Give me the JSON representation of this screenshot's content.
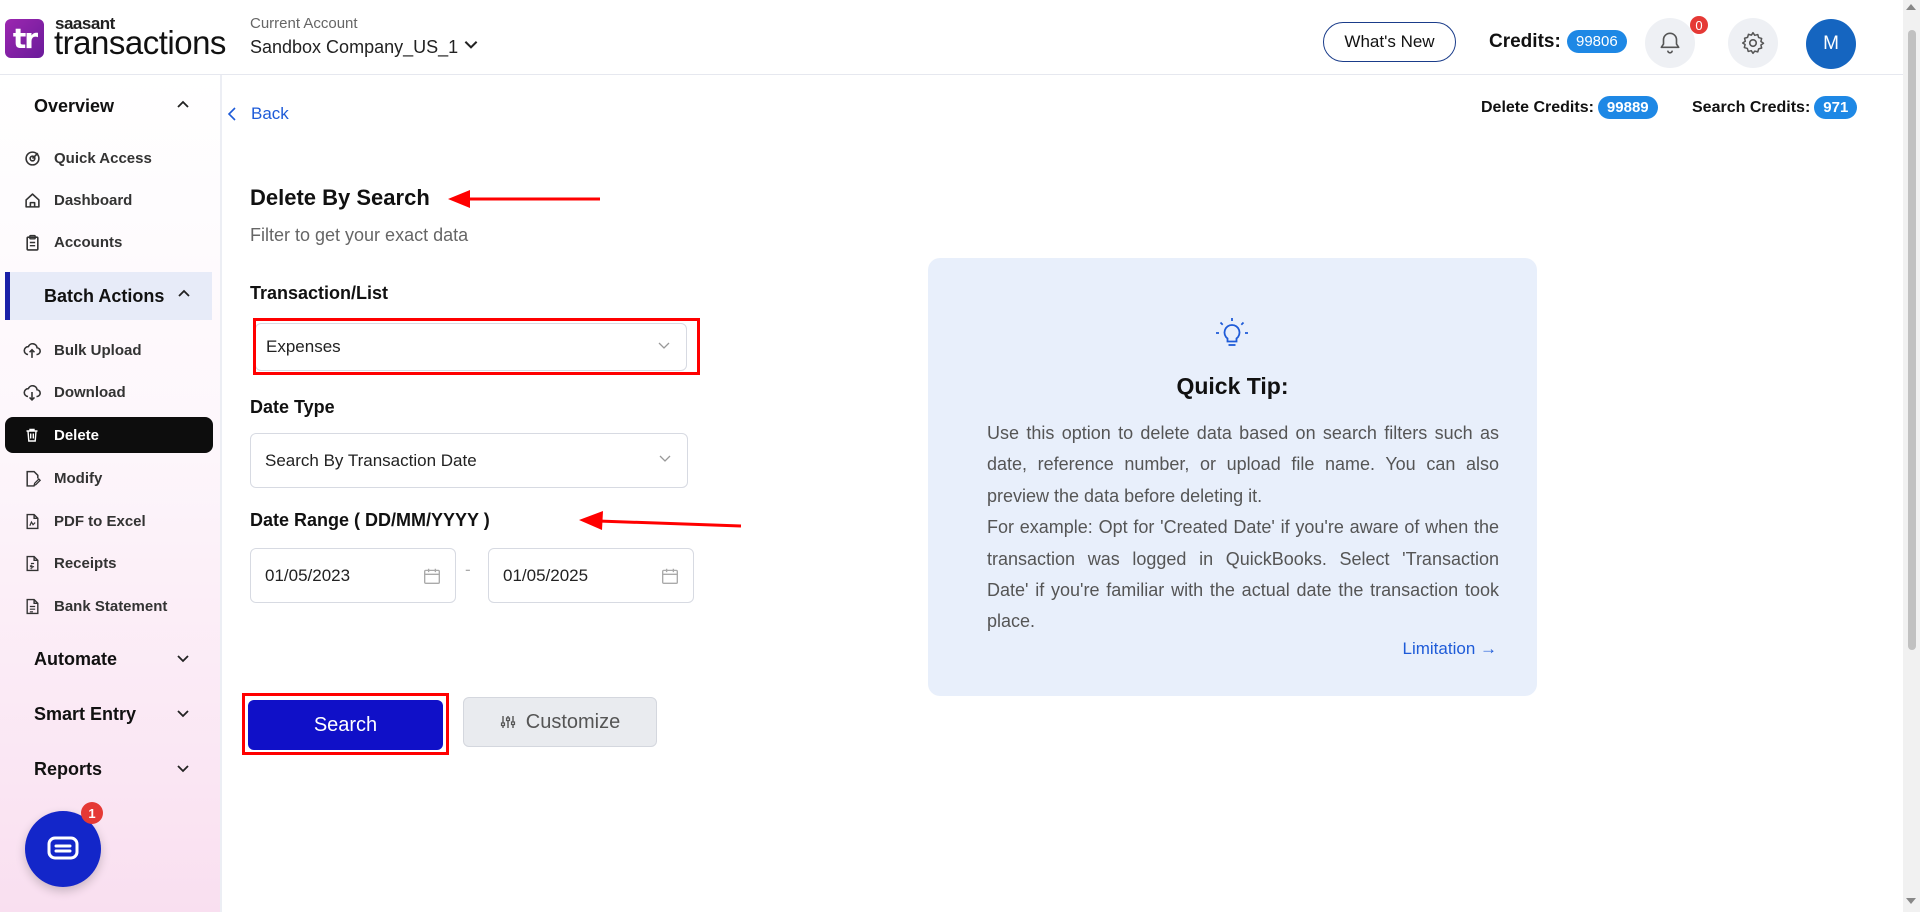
{
  "header": {
    "logo_mark": "tr",
    "logo_small": "saasant",
    "logo_big": "transactions",
    "account_label": "Current Account",
    "account_name": "Sandbox Company_US_1",
    "whats_new": "What's New",
    "credits_label": "Credits:",
    "credits_value": "99806",
    "notification_count": "0",
    "avatar_initial": "M"
  },
  "sidebar": {
    "overview": "Overview",
    "overview_items": [
      {
        "label": "Quick Access",
        "icon": "quick-access-icon"
      },
      {
        "label": "Dashboard",
        "icon": "home-icon"
      },
      {
        "label": "Accounts",
        "icon": "clipboard-icon"
      }
    ],
    "batch_actions": "Batch Actions",
    "batch_items": [
      {
        "label": "Bulk Upload",
        "icon": "cloud-upload-icon"
      },
      {
        "label": "Download",
        "icon": "cloud-download-icon"
      },
      {
        "label": "Delete",
        "icon": "trash-icon"
      },
      {
        "label": "Modify",
        "icon": "edit-file-icon"
      },
      {
        "label": "PDF to Excel",
        "icon": "pdf-icon"
      },
      {
        "label": "Receipts",
        "icon": "receipt-icon"
      },
      {
        "label": "Bank Statement",
        "icon": "bank-statement-icon"
      }
    ],
    "automate": "Automate",
    "smart_entry": "Smart Entry",
    "reports": "Reports",
    "chat_badge": "1"
  },
  "main": {
    "back": "Back",
    "delete_credits_label": "Delete Credits:",
    "delete_credits_value": "99889",
    "search_credits_label": "Search Credits:",
    "search_credits_value": "971",
    "title": "Delete By Search",
    "subtitle": "Filter to get your exact data",
    "transaction_label": "Transaction/List",
    "transaction_value": "Expenses",
    "date_type_label": "Date Type",
    "date_type_value": "Search By Transaction Date",
    "date_range_label": "Date Range ( DD/MM/YYYY )",
    "date_from": "01/05/2023",
    "date_separator": "-",
    "date_to": "01/05/2025",
    "search_button": "Search",
    "customize_button": "Customize"
  },
  "tip": {
    "title": "Quick Tip:",
    "para1": "Use this option to delete data based on search filters such as date, reference number, or upload file name. You can also preview the data before deleting it.",
    "para2": "For example: Opt for 'Created Date' if you're aware of when the transaction was logged in QuickBooks. Select 'Transaction Date' if you're familiar with the actual date the transaction took place.",
    "link": "Limitation →"
  },
  "colors": {
    "primary_button": "#1010c8",
    "pill_blue": "#1e88e5",
    "annotation_red": "#ff0000",
    "active_nav": "#0d0d0d",
    "tip_bg": "#e8effb"
  }
}
